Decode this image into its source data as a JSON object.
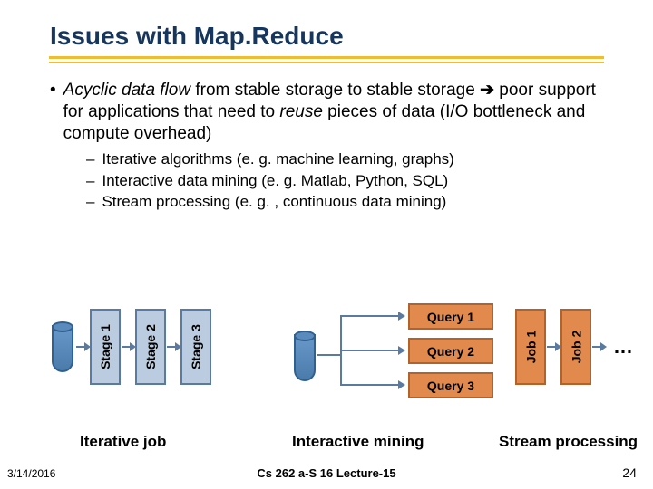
{
  "title": "Issues with Map.Reduce",
  "bullet": {
    "segments": {
      "italic1": "Acyclic data flow",
      "plain1": " from stable storage to stable storage ",
      "arrow": "è",
      "plain2": " poor support for applications that need to ",
      "italic2": "reuse",
      "plain3": " pieces of data (I/O bottleneck and compute overhead)"
    }
  },
  "sub": [
    "Iterative algorithms (e. g. machine learning, graphs)",
    "Interactive data mining (e. g. Matlab, Python, SQL)",
    "Stream processing (e. g. , continuous data mining)"
  ],
  "diagram": {
    "stages": [
      "Stage 1",
      "Stage 2",
      "Stage 3"
    ],
    "queries": [
      "Query 1",
      "Query 2",
      "Query 3"
    ],
    "jobs": [
      "Job 1",
      "Job 2"
    ],
    "ellipsis": "…",
    "captions": {
      "iter": "Iterative job",
      "mine": "Interactive mining",
      "stream": "Stream processing"
    }
  },
  "footer": {
    "left": "3/14/2016",
    "center": "Cs 262 a-S 16 Lecture-15",
    "right": "24"
  }
}
